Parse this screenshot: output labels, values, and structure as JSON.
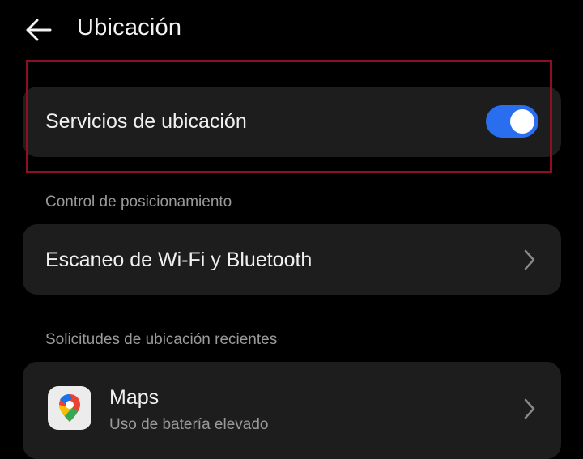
{
  "header": {
    "title": "Ubicación",
    "back_icon": "arrow-left-icon"
  },
  "location_services": {
    "label": "Servicios de ubicación",
    "toggle_on": true,
    "toggle_color": "#2a6ef0"
  },
  "positioning_control": {
    "section_label": "Control de posicionamiento",
    "scan_label": "Escaneo de Wi-Fi y Bluetooth"
  },
  "recent_requests": {
    "section_label": "Solicitudes de ubicación recientes",
    "apps": [
      {
        "name": "Maps",
        "subtitle": "Uso de batería elevado",
        "icon": "google-maps-icon"
      }
    ]
  },
  "colors": {
    "background": "#000000",
    "card": "#1d1d1d",
    "highlight": "#8a1022"
  }
}
